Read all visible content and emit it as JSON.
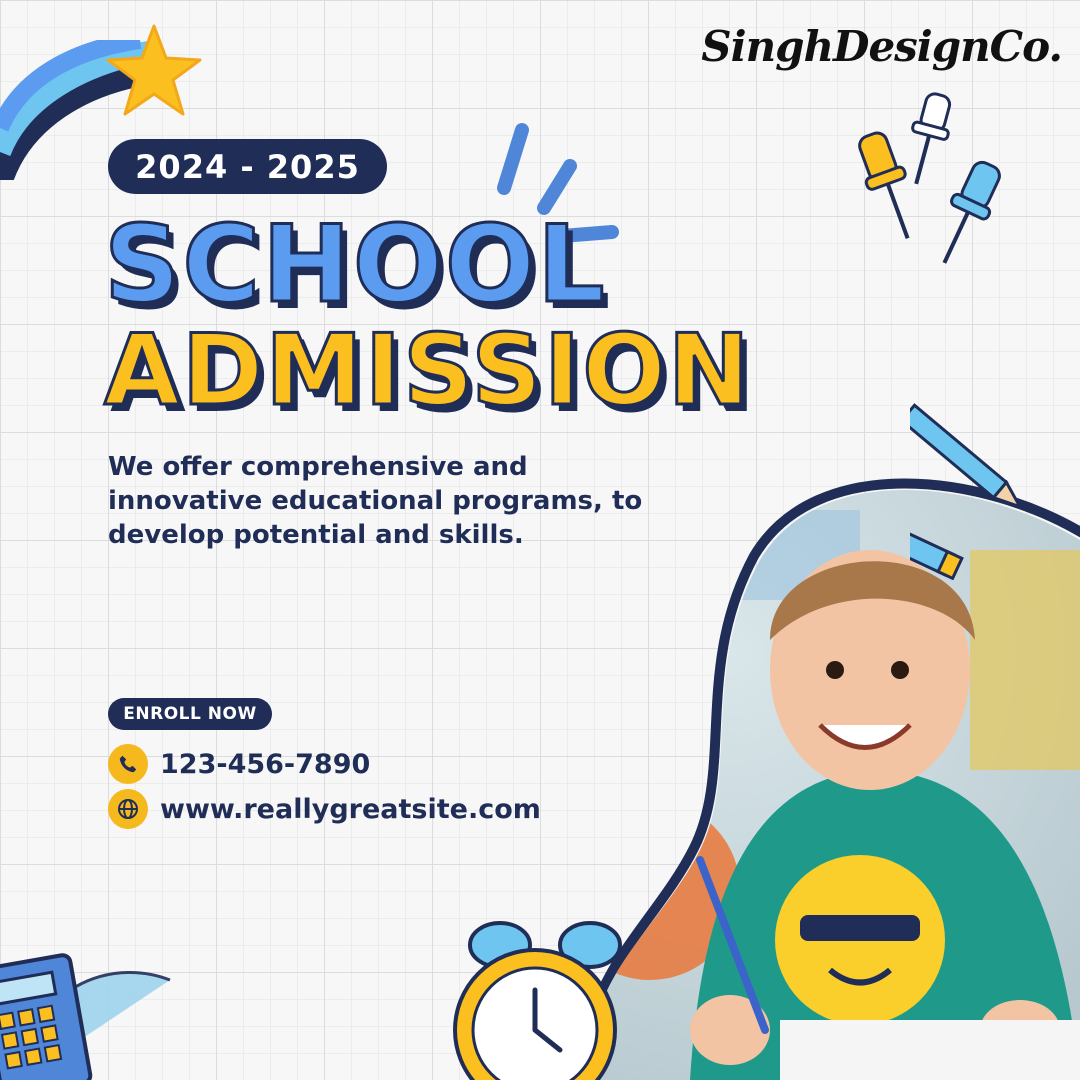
{
  "brand": {
    "name": "SinghDesignCo."
  },
  "header": {
    "year": "2024 - 2025"
  },
  "title": {
    "line1": "SCHOOL",
    "line2": "ADMISSION"
  },
  "description": "We offer comprehensive and innovative educational programs, to develop potential and skills.",
  "cta": {
    "enroll_label": "ENROLL NOW"
  },
  "contact": {
    "phone": "123-456-7890",
    "website": "www.reallygreatsite.com",
    "phone_icon": "phone-icon",
    "web_icon": "globe-icon"
  },
  "colors": {
    "navy": "#1f2d57",
    "blue": "#5b9cf0",
    "yellow": "#fbbf1f",
    "sky": "#6ec6f0"
  },
  "decor_icons": [
    "star-icon",
    "pushpin-icon",
    "pencil-icon",
    "alarm-clock-icon",
    "calculator-icon",
    "protractor-icon"
  ]
}
